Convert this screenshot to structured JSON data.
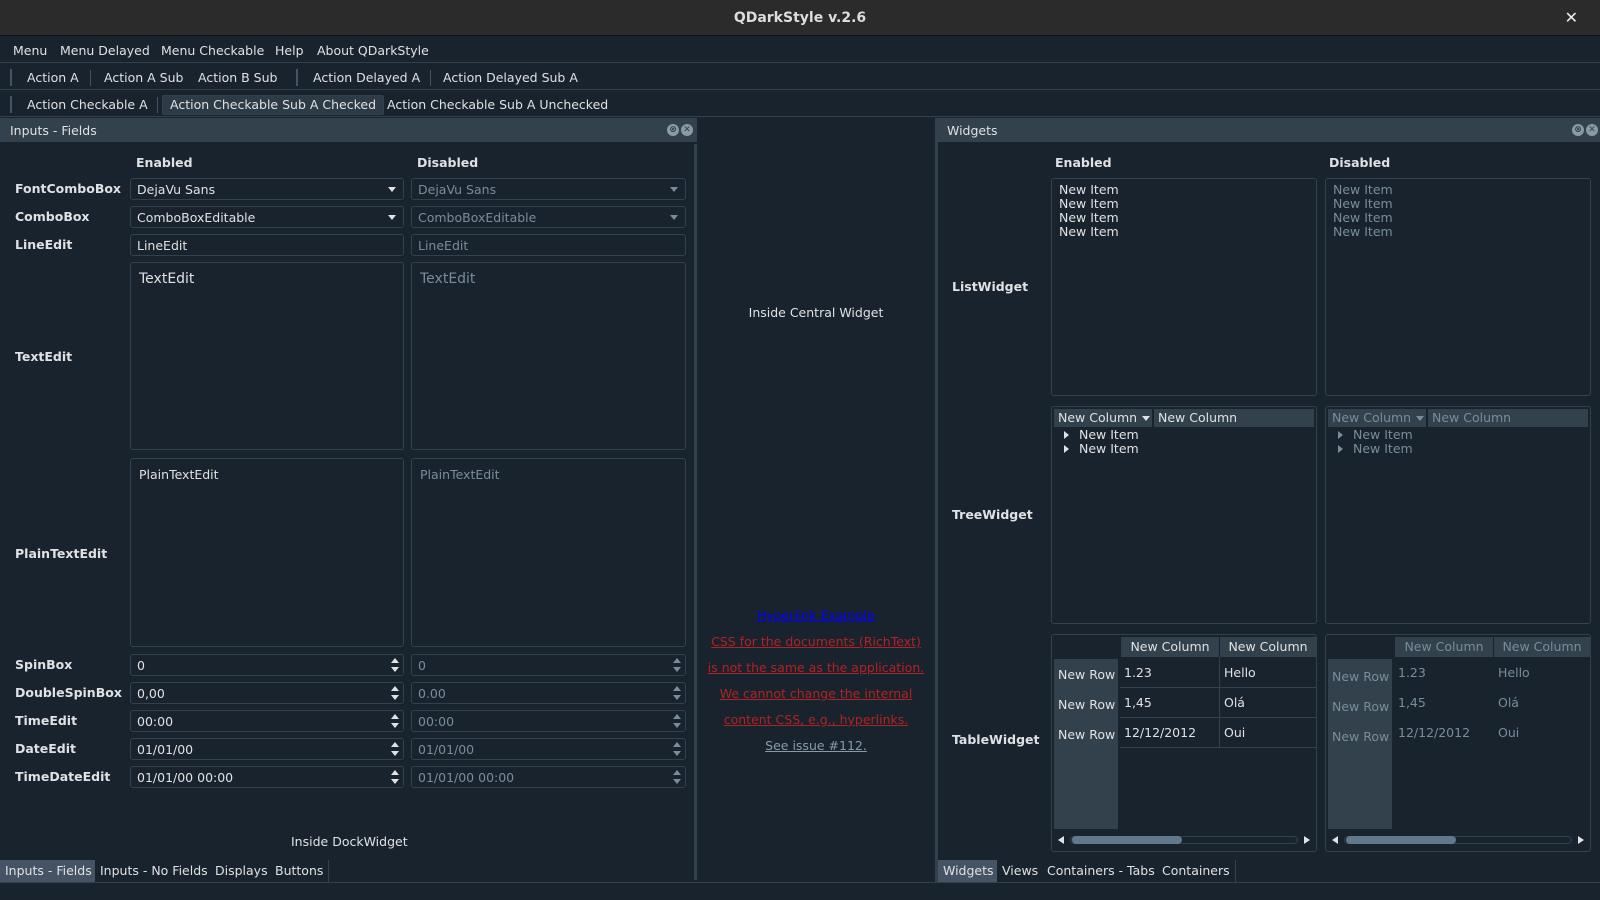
{
  "window": {
    "title": "QDarkStyle v.2.6"
  },
  "menubar": [
    "Menu",
    "Menu Delayed",
    "Menu Checkable",
    "Help",
    "About QDarkStyle"
  ],
  "toolbar1": [
    "Action A",
    "Action A Sub",
    "Action B Sub",
    "Action Delayed A",
    "Action Delayed Sub A"
  ],
  "toolbar2": [
    "Action Checkable A",
    "Action Checkable Sub A Checked",
    "Action Checkable Sub A Unchecked"
  ],
  "left_dock": {
    "title": "Inputs - Fields",
    "col_enabled": "Enabled",
    "col_disabled": "Disabled",
    "labels": {
      "fontcombo": "FontComboBox",
      "combo": "ComboBox",
      "lineedit": "LineEdit",
      "textedit": "TextEdit",
      "plaintext": "PlainTextEdit",
      "spin": "SpinBox",
      "dspin": "DoubleSpinBox",
      "time": "TimeEdit",
      "date": "DateEdit",
      "datetime": "TimeDateEdit"
    },
    "values": {
      "fontcombo": "DejaVu Sans",
      "combo": "ComboBoxEditable",
      "lineedit": "LineEdit",
      "textedit": "TextEdit",
      "plaintext": "PlainTextEdit",
      "spin": "0",
      "dspin_enabled": "0,00",
      "dspin_disabled": "0.00",
      "time": "00:00",
      "date": "01/01/00",
      "datetime": "01/01/00 00:00"
    },
    "footer": "Inside DockWidget",
    "tabs": [
      "Inputs - Fields",
      "Inputs - No Fields",
      "Displays",
      "Buttons"
    ]
  },
  "central": {
    "label": "Inside Central Widget",
    "hyperlink": "Hyperlink Example",
    "red_lines": [
      "CSS for the documents (RichText)",
      "is not the same as the application.",
      "We cannot change the internal",
      "content CSS, e.g., hyperlinks."
    ],
    "issue": "See issue #112."
  },
  "right_dock": {
    "title": "Widgets",
    "col_enabled": "Enabled",
    "col_disabled": "Disabled",
    "labels": {
      "list": "ListWidget",
      "tree": "TreeWidget",
      "table": "TableWidget"
    },
    "list_items": [
      "New Item",
      "New Item",
      "New Item",
      "New Item"
    ],
    "tree": {
      "col1": "New Column",
      "col2": "New Column",
      "items": [
        "New Item",
        "New Item"
      ]
    },
    "table": {
      "columns": [
        "New Column",
        "New Column"
      ],
      "rows": [
        {
          "label": "New Row",
          "c1": "1.23",
          "c2": "Hello"
        },
        {
          "label": "New Row",
          "c1": "1,45",
          "c2": "Olá"
        },
        {
          "label": "New Row",
          "c1": "12/12/2012",
          "c2": "Oui"
        }
      ]
    },
    "tabs": [
      "Widgets",
      "Views",
      "Containers - Tabs",
      "Containers"
    ]
  },
  "colors": {
    "background": "#19232d",
    "panel": "#32414b",
    "accent": "#455364",
    "link": "#0000ff",
    "warning": "#b22222"
  }
}
